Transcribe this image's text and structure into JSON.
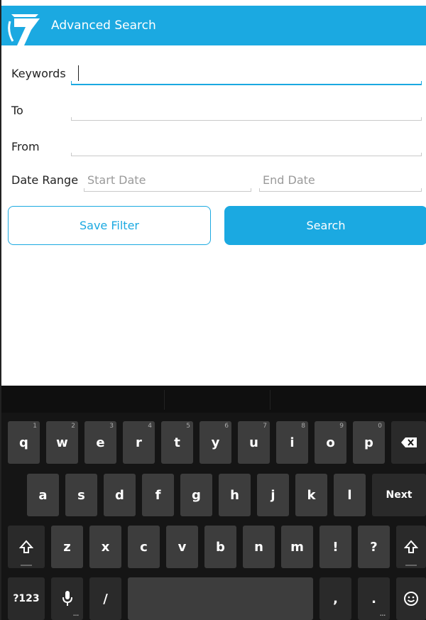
{
  "app": {
    "title": "Advanced Search"
  },
  "form": {
    "keywords_label": "Keywords",
    "to_label": "To",
    "from_label": "From",
    "date_range_label": "Date Range",
    "start_date_placeholder": "Start Date",
    "end_date_placeholder": "End Date"
  },
  "buttons": {
    "save_filter": "Save Filter",
    "search": "Search"
  },
  "keyboard": {
    "row1": [
      {
        "label": "q",
        "hint": "1"
      },
      {
        "label": "w",
        "hint": "2"
      },
      {
        "label": "e",
        "hint": "3"
      },
      {
        "label": "r",
        "hint": "4"
      },
      {
        "label": "t",
        "hint": "5"
      },
      {
        "label": "y",
        "hint": "6"
      },
      {
        "label": "u",
        "hint": "7"
      },
      {
        "label": "i",
        "hint": "8"
      },
      {
        "label": "o",
        "hint": "9"
      },
      {
        "label": "p",
        "hint": "0"
      }
    ],
    "row2": [
      "a",
      "s",
      "d",
      "f",
      "g",
      "h",
      "j",
      "k",
      "l"
    ],
    "row3": [
      "z",
      "x",
      "c",
      "v",
      "b",
      "n",
      "m",
      "!",
      "?"
    ],
    "next_label": "Next",
    "symbols_label": "?123",
    "slash_label": "/",
    "comma_label": ",",
    "period_label": "."
  },
  "colors": {
    "accent": "#1ba9e1",
    "keyboard_bg": "#151515",
    "key_bg": "#3d3d3d"
  },
  "icons": {
    "logo": "app-logo",
    "backspace": "backspace-icon",
    "shift": "shift-icon",
    "mic": "microphone-icon",
    "emoji": "emoji-icon"
  }
}
